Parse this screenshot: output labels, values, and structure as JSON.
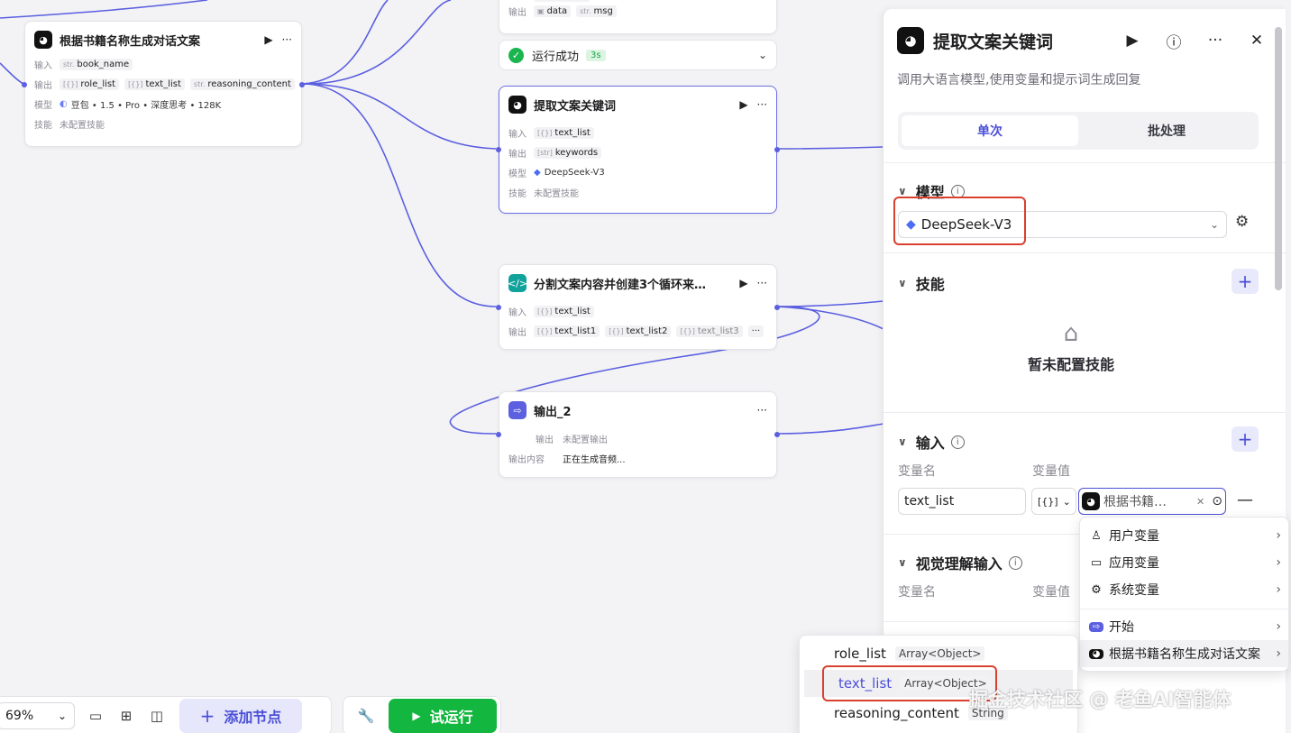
{
  "nodes": {
    "book_node": {
      "title": "根据书籍名称生成对话文案",
      "input_label": "输入",
      "input_var": "book_name",
      "input_type": "str.",
      "output_label": "输出",
      "outputs": [
        {
          "type": "[{}]",
          "name": "role_list"
        },
        {
          "type": "[{}]",
          "name": "text_list"
        },
        {
          "type": "str.",
          "name": "reasoning_content"
        }
      ],
      "model_label": "模型",
      "model_value": "豆包 • 1.5 • Pro • 深度思考 • 128K",
      "skill_label": "技能",
      "skill_value": "未配置技能"
    },
    "top_node": {
      "output_label": "输出",
      "outputs": [
        {
          "type": "img",
          "name": "data"
        },
        {
          "type": "str.",
          "name": "msg"
        }
      ],
      "partial_top": "watermark"
    },
    "run_status": {
      "label": "运行成功",
      "time": "3s"
    },
    "keyword_node": {
      "title": "提取文案关键词",
      "input_label": "输入",
      "input_var": "text_list",
      "input_type": "[{}]",
      "output_label": "输出",
      "output_var": "keywords",
      "output_type": "[str]",
      "model_label": "模型",
      "model_value": "DeepSeek-V3",
      "skill_label": "技能",
      "skill_value": "未配置技能"
    },
    "split_node": {
      "title": "分割文案内容并创建3个循环来…",
      "input_label": "输入",
      "input_var": "text_list",
      "output_label": "输出",
      "outputs": [
        "text_list1",
        "text_list2",
        "text_list3"
      ],
      "more": "···"
    },
    "output_node": {
      "title": "输出_2",
      "output_label": "输出",
      "output_value": "未配置输出",
      "content_label": "输出内容",
      "content_value": "正在生成音频..."
    }
  },
  "panel": {
    "title": "提取文案关键词",
    "description": "调用大语言模型,使用变量和提示词生成回复",
    "tabs": [
      "单次",
      "批处理"
    ],
    "model_section": "模型",
    "model_value": "DeepSeek-V3",
    "skill_section": "技能",
    "skill_empty": "暂未配置技能",
    "input_section": "输入",
    "var_name_label": "变量名",
    "var_value_label": "变量值",
    "input_name": "text_list",
    "input_type": "[{}]",
    "input_ref": "根据书籍…",
    "vision_section": "视觉理解输入",
    "vision_name_label": "变量名",
    "vision_value_label": "变量值"
  },
  "var_menu": {
    "items": [
      "用户变量",
      "应用变量",
      "系统变量",
      "开始",
      "根据书籍名称生成对话文案"
    ]
  },
  "sub_menu": {
    "items": [
      {
        "name": "role_list",
        "type": "Array<Object>"
      },
      {
        "name": "text_list",
        "type": "Array<Object>"
      },
      {
        "name": "reasoning_content",
        "type": "String"
      }
    ]
  },
  "toolbar": {
    "zoom": "69%",
    "add_node": "添加节点",
    "test_run": "试运行"
  },
  "watermark": "掘金技术社区 @ 老鱼AI智能体",
  "colors": {
    "accent": "#5b5fe0",
    "success": "#1ab54f",
    "highlight": "#d9402e"
  }
}
